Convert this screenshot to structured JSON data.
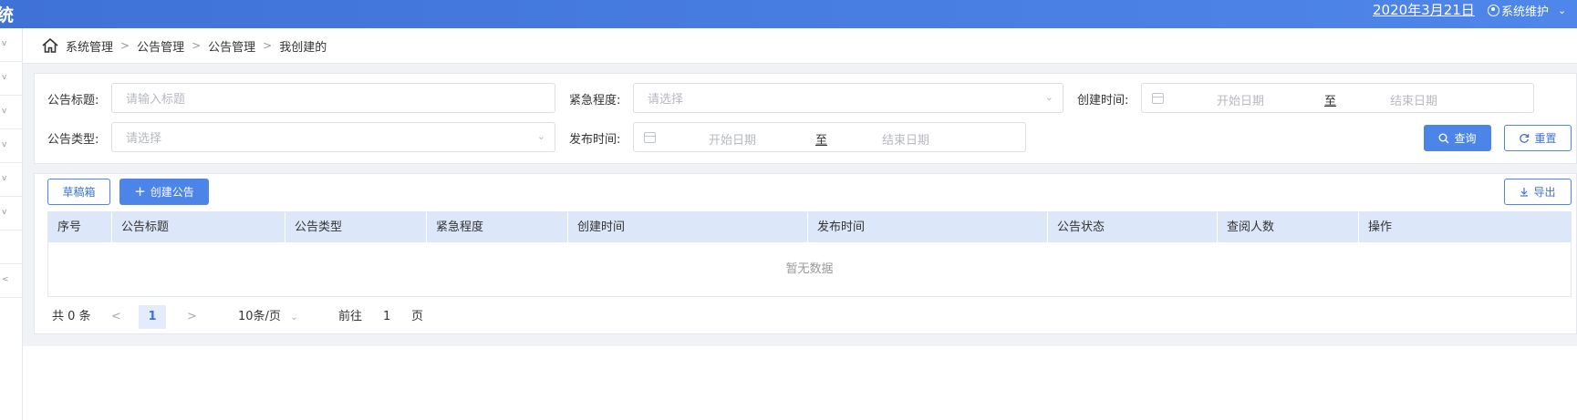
{
  "header": {
    "brand_fragment": "统",
    "date": "2020年3月21日",
    "user": "系统维护",
    "user_icon": "user-circle-icon",
    "dropdown_icon": "chevron-down-icon",
    "colors": {
      "bar": "#4579de",
      "accent": "#4c84e8"
    }
  },
  "sidebar": {
    "items": [
      "v",
      "v",
      "v",
      "v",
      "v",
      "v",
      "",
      "<"
    ]
  },
  "breadcrumb": {
    "home_icon": "home-icon",
    "items": [
      "系统管理",
      "公告管理",
      "公告管理",
      "我创建的"
    ]
  },
  "search": {
    "title_label": "公告标题:",
    "title_placeholder": "请输入标题",
    "urgency_label": "紧急程度:",
    "urgency_placeholder": "请选择",
    "created_label": "创建时间:",
    "created_start": "开始日期",
    "created_to": "至",
    "created_end": "结束日期",
    "type_label": "公告类型:",
    "type_placeholder": "请选择",
    "publish_label": "发布时间:",
    "publish_start": "开始日期",
    "publish_to": "至",
    "publish_end": "结束日期",
    "query_button": "查询",
    "reset_button": "重置"
  },
  "toolbar": {
    "drafts_button": "草稿箱",
    "create_button": "创建公告",
    "export_button": "导出"
  },
  "table": {
    "columns": [
      "序号",
      "公告标题",
      "公告类型",
      "紧急程度",
      "创建时间",
      "发布时间",
      "公告状态",
      "查阅人数",
      "操作"
    ],
    "rows": [],
    "empty_text": "暂无数据"
  },
  "pagination": {
    "total": "共 0 条",
    "current_page": "1",
    "page_size": "10条/页",
    "goto_prefix": "前往",
    "goto_value": "1",
    "goto_suffix": "页"
  }
}
